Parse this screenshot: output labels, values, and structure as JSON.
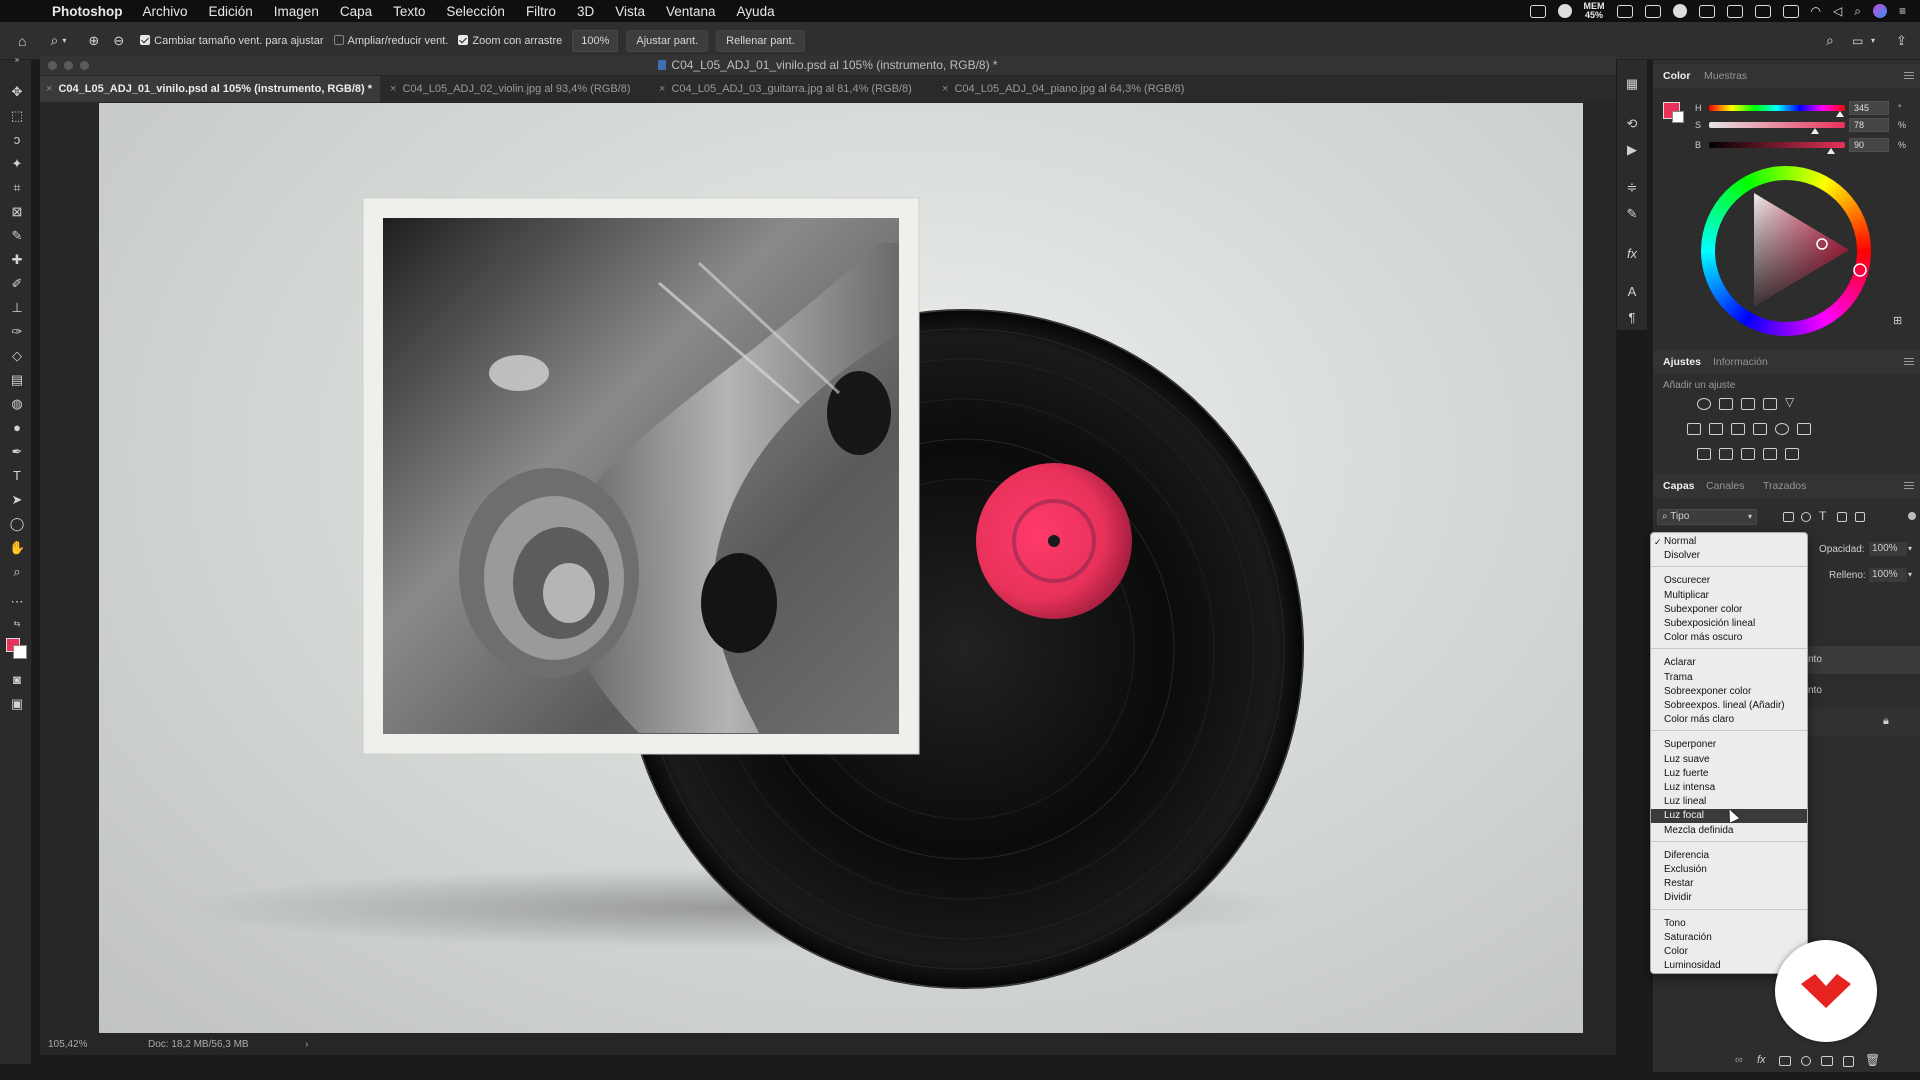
{
  "menubar": {
    "app_name": "Photoshop",
    "items": [
      "Archivo",
      "Edición",
      "Imagen",
      "Capa",
      "Texto",
      "Selección",
      "Filtro",
      "3D",
      "Vista",
      "Ventana",
      "Ayuda"
    ],
    "mem_label": "MEM",
    "mem_value": "45%"
  },
  "options_bar": {
    "check1_label": "Cambiar tamaño vent. para ajustar",
    "check2_label": "Ampliar/reducir vent.",
    "check3_label": "Zoom con arrastre",
    "zoom_field": "100%",
    "fit_button": "Ajustar pant.",
    "fill_button": "Rellenar pant."
  },
  "document": {
    "window_title": "C04_L05_ADJ_01_vinilo.psd al 105% (instrumento, RGB/8) *",
    "tabs": [
      {
        "label": "C04_L05_ADJ_01_vinilo.psd al 105% (instrumento, RGB/8) *",
        "active": true
      },
      {
        "label": "C04_L05_ADJ_02_violin.jpg al 93,4% (RGB/8)",
        "active": false
      },
      {
        "label": "C04_L05_ADJ_03_guitarra.jpg al 81,4% (RGB/8)",
        "active": false
      },
      {
        "label": "C04_L05_ADJ_04_piano.jpg al 64,3% (RGB/8)",
        "active": false
      }
    ],
    "zoom_status": "105,42%",
    "doc_status": "Doc: 18,2 MB/56,3 MB"
  },
  "color_panel": {
    "tabs": [
      "Color",
      "Muestras"
    ],
    "h_label": "H",
    "h_value": "345",
    "h_unit": "°",
    "h_level": 0.96,
    "s_label": "S",
    "s_value": "78",
    "s_unit": "%",
    "s_level": 0.78,
    "b_label": "B",
    "b_value": "90",
    "b_unit": "%",
    "b_level": 0.9,
    "foreground_color": "#e8325a"
  },
  "adjustments_panel": {
    "tabs": [
      "Ajustes",
      "Información"
    ],
    "hint": "Añadir un ajuste"
  },
  "layers_panel": {
    "tabs": [
      "Capas",
      "Canales",
      "Trazados"
    ],
    "filter_label": "Tipo",
    "opacity_label": "Opacidad:",
    "opacity_value": "100%",
    "fill_label": "Relleno:",
    "fill_value": "100%",
    "layer_frag_1": "nto",
    "layer_frag_2": "nto"
  },
  "blend_modes": {
    "groups": [
      [
        "Normal",
        "Disolver"
      ],
      [
        "Oscurecer",
        "Multiplicar",
        "Subexponer color",
        "Subexposición lineal",
        "Color más oscuro"
      ],
      [
        "Aclarar",
        "Trama",
        "Sobreexponer color",
        "Sobreexpos. lineal (Añadir)",
        "Color más claro"
      ],
      [
        "Superponer",
        "Luz suave",
        "Luz fuerte",
        "Luz intensa",
        "Luz lineal",
        "Luz focal",
        "Mezcla definida"
      ],
      [
        "Diferencia",
        "Exclusión",
        "Restar",
        "Dividir"
      ],
      [
        "Tono",
        "Saturación",
        "Color",
        "Luminosidad"
      ]
    ],
    "checked": "Normal",
    "highlighted": "Luz focal"
  },
  "colors": {
    "accent_red": "#e8325a",
    "brand_red": "#e6231e"
  }
}
